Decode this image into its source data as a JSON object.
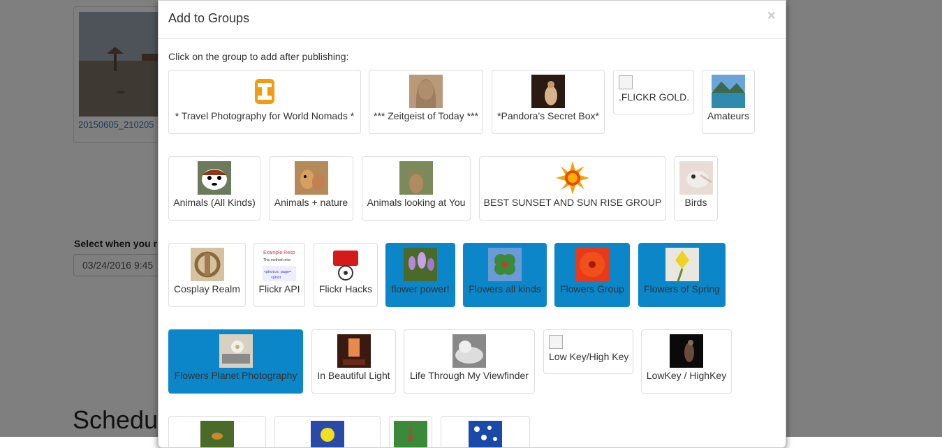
{
  "background": {
    "photo_caption": "20150605_210205",
    "schedule_label": "Select when you r",
    "date_value": "03/24/2016 9:45",
    "schedule_heading": "Schedu"
  },
  "modal": {
    "title": "Add to Groups",
    "close": "×",
    "instructions": "Click on the group to add after publishing:",
    "groups": [
      {
        "name": "* Travel Photography for World Nomads *",
        "icon": "travel-logo-icon",
        "selected": false
      },
      {
        "name": "*** Zeitgeist of Today ***",
        "icon": "portrait-thumb",
        "selected": false
      },
      {
        "name": "*Pandora's Secret Box*",
        "icon": "painting-thumb",
        "selected": false
      },
      {
        "name": ".FLICKR GOLD.",
        "icon": "broken-image-icon",
        "selected": false
      },
      {
        "name": "Amateurs",
        "icon": "lake-thumb",
        "selected": false
      },
      {
        "name": "Animals (All Kinds)",
        "icon": "red-panda-thumb",
        "selected": false
      },
      {
        "name": "Animals + nature",
        "icon": "dogs-thumb",
        "selected": false
      },
      {
        "name": "Animals looking at You",
        "icon": "deer-thumb",
        "selected": false
      },
      {
        "name": "BEST SUNSET AND SUN RISE GROUP",
        "icon": "sun-icon",
        "selected": false
      },
      {
        "name": "Birds",
        "icon": "bird-thumb",
        "selected": false
      },
      {
        "name": "Cosplay Realm",
        "icon": "cosplay-thumb",
        "selected": false
      },
      {
        "name": "Flickr API",
        "icon": "code-snippet-thumb",
        "selected": false
      },
      {
        "name": "Flickr Hacks",
        "icon": "viewmaster-thumb",
        "selected": false
      },
      {
        "name": "flower power!",
        "icon": "crocus-thumb",
        "selected": true
      },
      {
        "name": "Flowers all kinds",
        "icon": "clover-thumb",
        "selected": true
      },
      {
        "name": "Flowers Group",
        "icon": "hibiscus-thumb",
        "selected": true
      },
      {
        "name": "Flowers of Spring",
        "icon": "daffodil-thumb",
        "selected": true
      },
      {
        "name": "Flowers Planet Photography",
        "icon": "flower-book-thumb",
        "selected": true
      },
      {
        "name": "In Beautiful Light",
        "icon": "window-light-thumb",
        "selected": false
      },
      {
        "name": "Life Through My Viewfinder",
        "icon": "baby-thumb",
        "selected": false
      },
      {
        "name": "Low Key/High Key",
        "icon": "broken-image-icon",
        "selected": false
      },
      {
        "name": "LowKey / HighKey",
        "icon": "dark-figure-thumb",
        "selected": false
      },
      {
        "name": "",
        "icon": "insect-thumb",
        "selected": false
      },
      {
        "name": "",
        "icon": "smiley-thumb",
        "selected": false
      },
      {
        "name": "",
        "icon": "leaf-thumb",
        "selected": false
      },
      {
        "name": "",
        "icon": "pattern-thumb",
        "selected": false
      }
    ]
  },
  "colors": {
    "selected": "#0a86c9",
    "link": "#337ab7"
  }
}
